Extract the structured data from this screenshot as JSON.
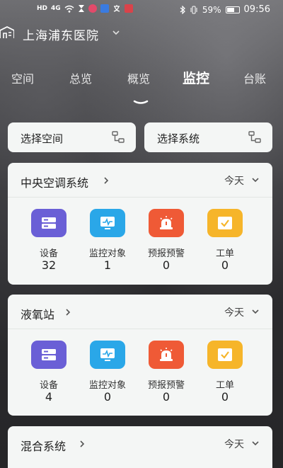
{
  "status_bar": {
    "network_left": "HD",
    "network_type": "4G",
    "battery": "59%",
    "time": "09:56"
  },
  "header": {
    "hospital_name": "上海浦东医院"
  },
  "tabs": [
    {
      "label": "空间",
      "active": false
    },
    {
      "label": "总览",
      "active": false
    },
    {
      "label": "概览",
      "active": false
    },
    {
      "label": "监控",
      "active": true
    },
    {
      "label": "台账",
      "active": false
    }
  ],
  "selectors": {
    "space_label": "选择空间",
    "system_label": "选择系统"
  },
  "colors": {
    "device": "#6a5fd6",
    "monitor": "#2aa7e8",
    "alarm": "#ef5a36",
    "workorder": "#f6b52a"
  },
  "systems": [
    {
      "name": "中央空调系统",
      "period": "今天",
      "metrics": [
        {
          "label": "设备",
          "value": "32",
          "icon": "device-icon"
        },
        {
          "label": "监控对象",
          "value": "1",
          "icon": "monitor-icon"
        },
        {
          "label": "预报预警",
          "value": "0",
          "icon": "alarm-icon"
        },
        {
          "label": "工单",
          "value": "0",
          "icon": "workorder-icon"
        }
      ]
    },
    {
      "name": "液氧站",
      "period": "今天",
      "metrics": [
        {
          "label": "设备",
          "value": "4",
          "icon": "device-icon"
        },
        {
          "label": "监控对象",
          "value": "0",
          "icon": "monitor-icon"
        },
        {
          "label": "预报预警",
          "value": "0",
          "icon": "alarm-icon"
        },
        {
          "label": "工单",
          "value": "0",
          "icon": "workorder-icon"
        }
      ]
    },
    {
      "name": "混合系统",
      "period": "今天"
    }
  ]
}
